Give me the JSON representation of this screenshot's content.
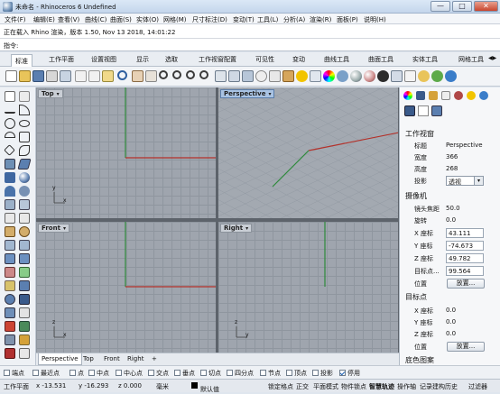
{
  "window": {
    "title": "未命名 - Rhinoceros 6 Undefined",
    "minimize": "—",
    "maximize": "□",
    "close": "✕"
  },
  "menubar": [
    "文件(F)",
    "编辑(E)",
    "查看(V)",
    "曲线(C)",
    "曲面(S)",
    "实体(O)",
    "网格(M)",
    "尺寸标注(D)",
    "变动(T)",
    "工具(L)",
    "分析(A)",
    "渲染(R)",
    "面板(P)",
    "说明(H)"
  ],
  "command_history": "正在载入 Rhino 渲染，版本 1.50, Nov 13 2018, 14:01:22",
  "command_prompt": "指令:",
  "tabs": [
    "标准",
    "工作平面",
    "设置视图",
    "显示",
    "选取",
    "工作视窗配置",
    "可见性",
    "变动",
    "曲线工具",
    "曲面工具",
    "实体工具",
    "网格工具"
  ],
  "tabs_scroll": "◀▶",
  "viewports": {
    "top": {
      "label": "Top"
    },
    "perspective": {
      "label": "Perspective"
    },
    "front": {
      "label": "Front"
    },
    "right": {
      "label": "Right"
    },
    "caret": "▾",
    "axis_x": "x",
    "axis_y": "y",
    "axis_z": "z"
  },
  "bottom_tabs": [
    "Perspective",
    "Top",
    "Front",
    "Right"
  ],
  "bottom_add": "+",
  "panel": {
    "section_viewport": "工作视窗",
    "title_k": "标题",
    "title_v": "Perspective",
    "width_k": "宽度",
    "width_v": "366",
    "height_k": "高度",
    "height_v": "268",
    "projection_k": "投影",
    "projection_v": "透视",
    "section_camera": "摄像机",
    "lens_k": "镜头焦距",
    "lens_v": "50.0",
    "rotation_k": "旋转",
    "rotation_v": "0.0",
    "cx_k": "X 座标",
    "cx_v": "43.111",
    "cy_k": "Y 座标",
    "cy_v": "-74.673",
    "cz_k": "Z 座标",
    "cz_v": "49.782",
    "target_dist_k": "目标点...",
    "target_dist_v": "99.564",
    "pos_k": "位置",
    "place_button": "放置...",
    "section_target": "目标点",
    "tx_k": "X 座标",
    "tx_v": "0.0",
    "ty_k": "Y 座标",
    "ty_v": "0.0",
    "tz_k": "Z 座标",
    "tz_v": "0.0",
    "tpos_k": "位置",
    "tplace_button": "放置...",
    "section_bg": "底色图案"
  },
  "osnap": [
    {
      "label": "端点",
      "on": false
    },
    {
      "label": "最近点",
      "on": false
    },
    {
      "label": "点",
      "on": false
    },
    {
      "label": "中点",
      "on": false
    },
    {
      "label": "中心点",
      "on": false
    },
    {
      "label": "交点",
      "on": false
    },
    {
      "label": "垂点",
      "on": false
    },
    {
      "label": "切点",
      "on": false
    },
    {
      "label": "四分点",
      "on": false
    },
    {
      "label": "节点",
      "on": false
    },
    {
      "label": "顶点",
      "on": false
    },
    {
      "label": "投影",
      "on": false
    },
    {
      "label": "停用",
      "on": true
    }
  ],
  "status": {
    "plane": "工作平面",
    "x": "x -13.531",
    "y": "y -16.293",
    "z": "z 0.000",
    "unit": "毫米",
    "layer": "默认值",
    "items": [
      "锁定格点",
      "正交",
      "平面模式",
      "物件锁点",
      "智慧轨迹",
      "操作轴",
      "记录建构历史",
      "过滤器"
    ]
  },
  "colors": {
    "accent": "#1a5fb4",
    "axis_red": "#b3312a",
    "axis_green": "#2d8a3a",
    "viewport_bg": "#9fa5ae"
  }
}
